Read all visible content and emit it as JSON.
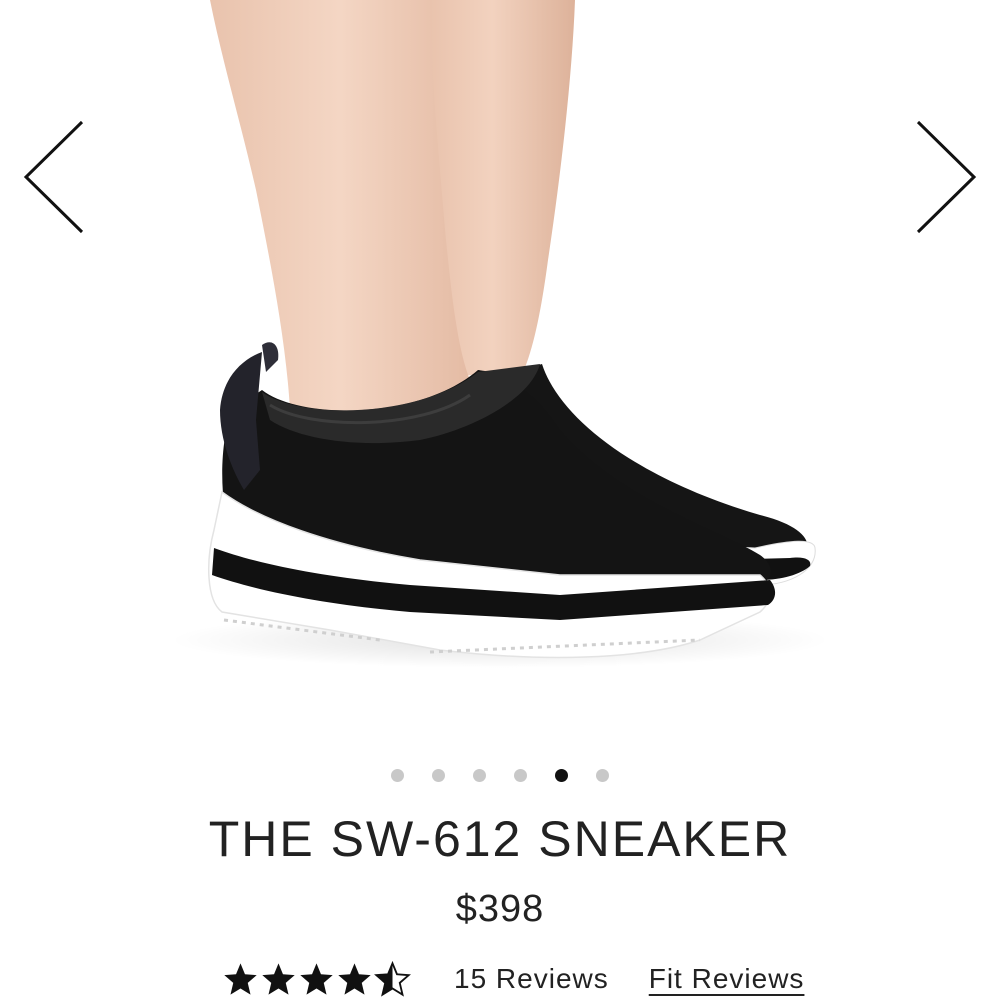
{
  "gallery": {
    "image": "product-photo-black-knit-slip-on-sneaker-white-black-striped-sole",
    "dot_count": 6,
    "active_dot": 5,
    "prev_icon": "chevron-left-icon",
    "next_icon": "chevron-right-icon"
  },
  "product": {
    "name": "THE SW-612 SNEAKER",
    "price": "$398",
    "rating": 4.5,
    "rating_max": 5,
    "review_count_label": "15 Reviews",
    "fit_reviews_label": "Fit Reviews"
  },
  "colors": {
    "text": "#222222",
    "dot_inactive": "#c8c8c8",
    "dot_active": "#111111",
    "shoe": "#161616",
    "sole": "#ffffff",
    "skin": "#efcdb8"
  }
}
